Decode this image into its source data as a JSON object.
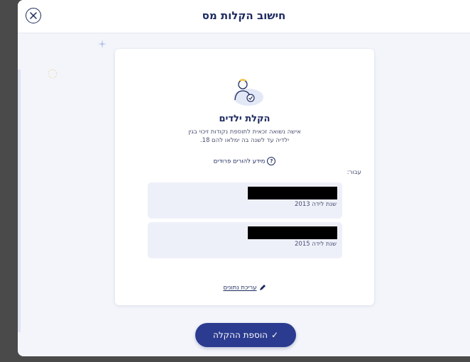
{
  "header": {
    "title": "חישוב הקלות מס"
  },
  "card": {
    "title": "הקלת ילדים",
    "description_line1": "אישה נשואה זכאית לתוספת נקודות זיכוי בגין",
    "description_line2": "ילדיה עד לשנה בה ימלאו להם 18.",
    "info_link": "מידע להורים פרודים",
    "for_label": "עבור:",
    "children": [
      {
        "birth_year_label": "שנת לידה 2013"
      },
      {
        "birth_year_label": "שנת לידה 2015"
      }
    ],
    "edit_link": "עריכת נתונים"
  },
  "footer": {
    "add_button": "הוספת ההקלה"
  },
  "colors": {
    "primary": "#2b3b8f",
    "title": "#1e2a60",
    "background": "#f3f5fb"
  }
}
